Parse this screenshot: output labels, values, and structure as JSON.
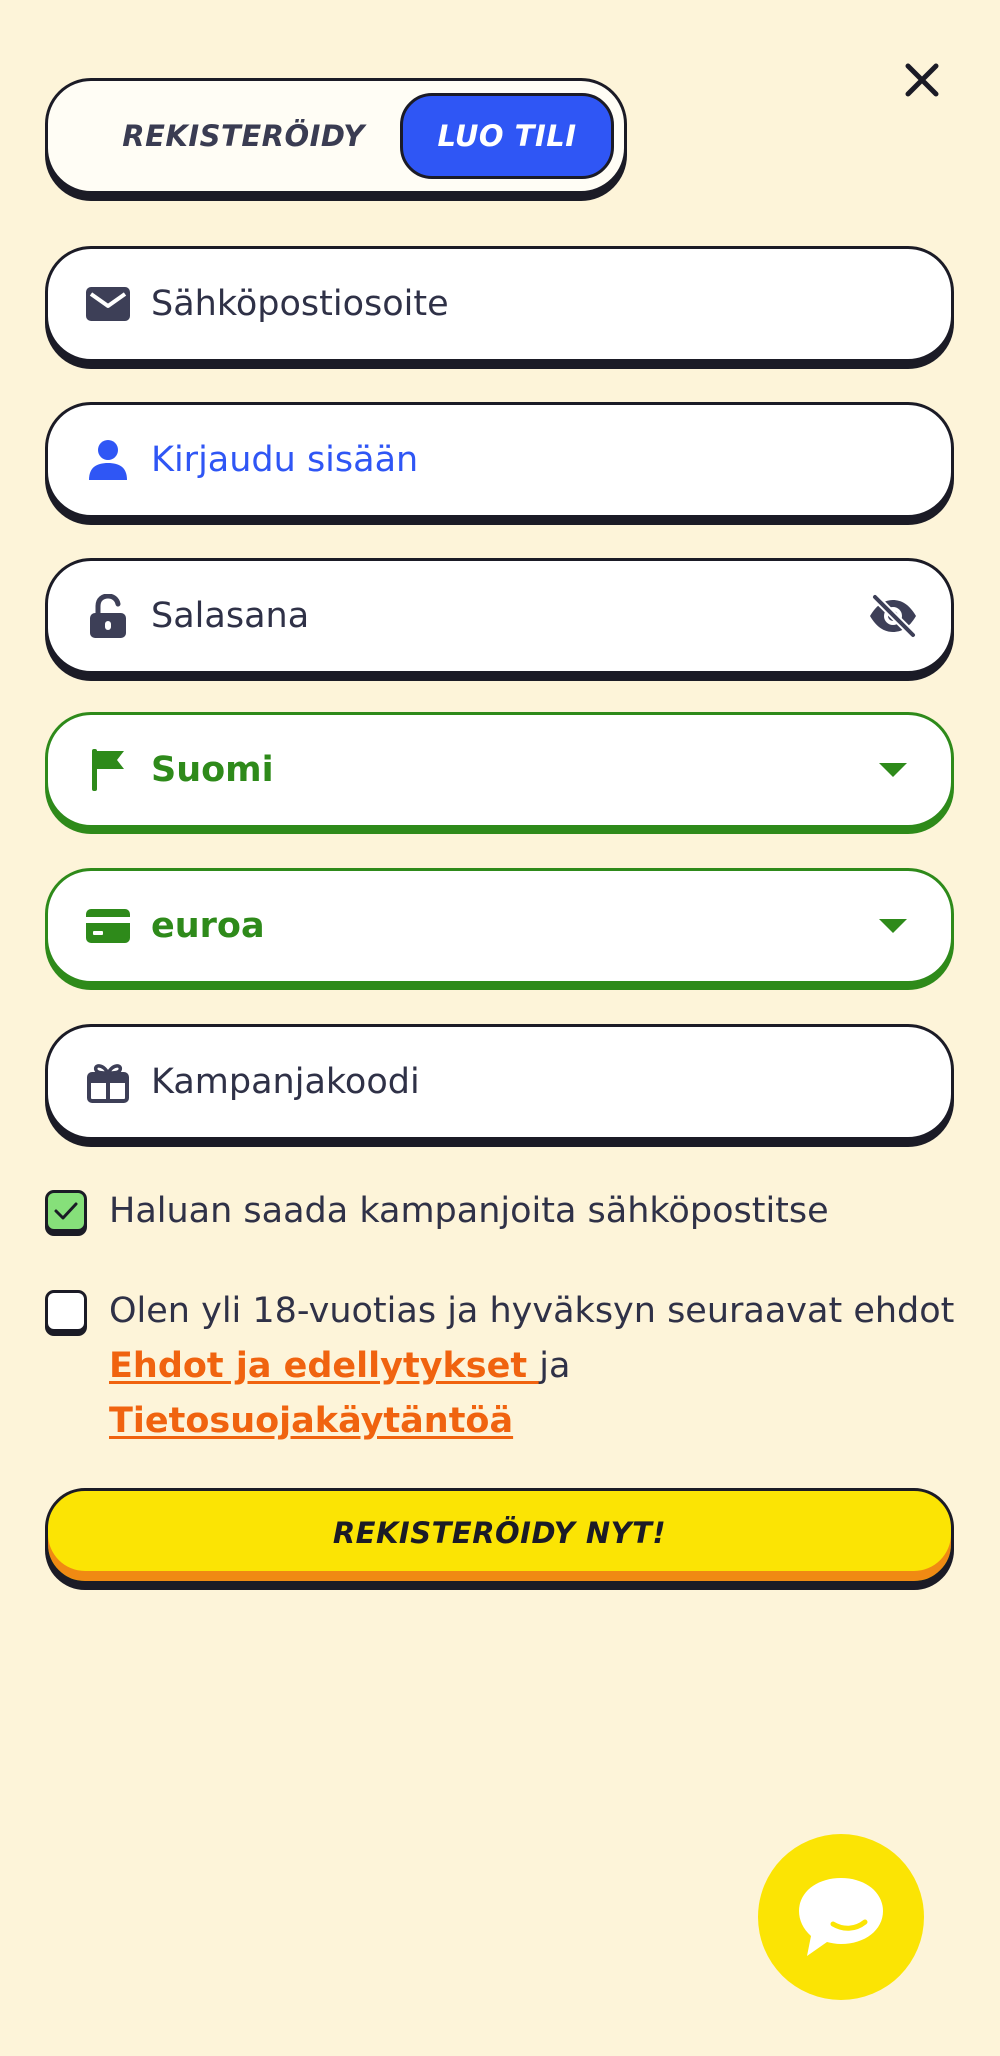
{
  "close": {
    "icon": "close-icon"
  },
  "toggle": {
    "left_label": "REKISTERÖIDY",
    "right_label": "LUO TILI"
  },
  "fields": {
    "email": {
      "placeholder": "Sähköpostiosoite",
      "icon": "envelope-icon"
    },
    "username": {
      "placeholder": "Kirjaudu sisään",
      "icon": "user-icon"
    },
    "password": {
      "placeholder": "Salasana",
      "icon": "lock-open-icon",
      "trail_icon": "eye-off-icon"
    },
    "country": {
      "value": "Suomi",
      "icon": "flag-icon"
    },
    "currency": {
      "value": "euroa",
      "icon": "card-icon"
    },
    "promo": {
      "placeholder": "Kampanjakoodi",
      "icon": "gift-icon"
    }
  },
  "consent": {
    "marketing_label": "Haluan saada kampanjoita sähköpostitse",
    "marketing_checked": true,
    "age_text_before": "Olen yli 18-vuotias ja hyväksyn seuraavat ehdot ",
    "terms_link": "Ehdot ja edellytykset ",
    "age_text_middle": "ja ",
    "privacy_link": "Tietosuojakäytäntöä",
    "age_checked": false
  },
  "submit_label": "REKISTERÖIDY NYT!",
  "colors": {
    "background": "#fdf4d9",
    "accent_blue": "#2f56f5",
    "accent_green": "#2e8a1a",
    "link_orange": "#f0630f",
    "cta_yellow": "#fbe404",
    "ink": "#1b1b26"
  }
}
